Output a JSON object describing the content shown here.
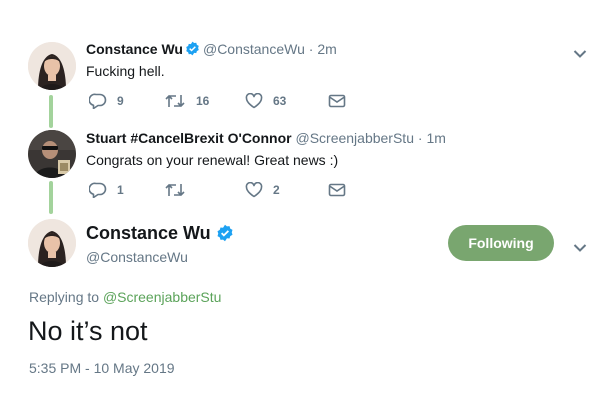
{
  "tweets": [
    {
      "name": "Constance Wu",
      "handle": "@ConstanceWu",
      "separator": "·",
      "time": "2m",
      "text": "Fucking hell.",
      "replies": "9",
      "retweets": "16",
      "likes": "63",
      "verified": true
    },
    {
      "name": "Stuart #CancelBrexit O'Connor",
      "handle": "@ScreenjabberStu",
      "separator": "·",
      "time": "1m",
      "text": "Congrats on your renewal! Great news :)",
      "replies": "1",
      "retweets": "",
      "likes": "2",
      "verified": false
    }
  ],
  "focused": {
    "name": "Constance Wu",
    "handle": "@ConstanceWu",
    "follow_label": "Following",
    "replying_prefix": "Replying to",
    "replying_to": "@ScreenjabberStu",
    "text": "No it’s not",
    "timestamp": "5:35 PM - 10 May 2019"
  },
  "colors": {
    "verified": "#1da1f2",
    "following_button": "#79a66f",
    "thread_line": "#a3d39c",
    "link": "#5ba35a",
    "muted": "#657786"
  },
  "icons": [
    "reply-icon",
    "retweet-icon",
    "like-icon",
    "message-icon",
    "chevron-down-icon",
    "verified-badge-icon"
  ]
}
